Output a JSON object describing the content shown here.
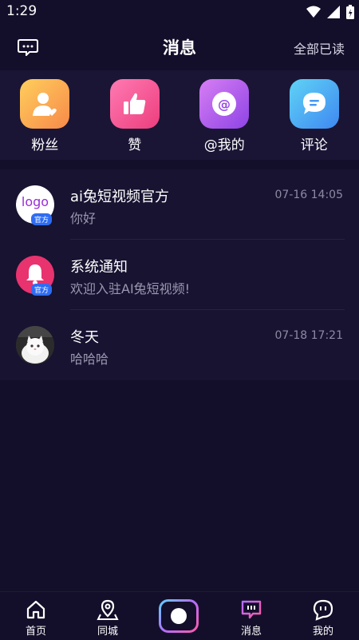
{
  "status": {
    "time": "1:29"
  },
  "header": {
    "title": "消息",
    "action": "全部已读"
  },
  "quick_actions": [
    {
      "label": "粉丝",
      "icon": "fans-icon"
    },
    {
      "label": "赞",
      "icon": "thumbs-up-icon"
    },
    {
      "label": "@我的",
      "icon": "at-icon"
    },
    {
      "label": "评论",
      "icon": "comment-icon"
    }
  ],
  "messages": [
    {
      "name": "ai兔短视频官方",
      "preview": "你好",
      "time": "07-16 14:05",
      "badge": "官方",
      "avatar_text": "logo"
    },
    {
      "name": "系统通知",
      "preview": "欢迎入驻AI兔短视频!",
      "time": "",
      "badge": "官方"
    },
    {
      "name": "冬天",
      "preview": "哈哈哈",
      "time": "07-18 17:21"
    }
  ],
  "nav": {
    "home": "首页",
    "city": "同城",
    "messages": "消息",
    "me": "我的"
  },
  "colors": {
    "background": "#130f2a",
    "accent_blue": "#2f6cf3",
    "notification_red": "#e8336f"
  }
}
